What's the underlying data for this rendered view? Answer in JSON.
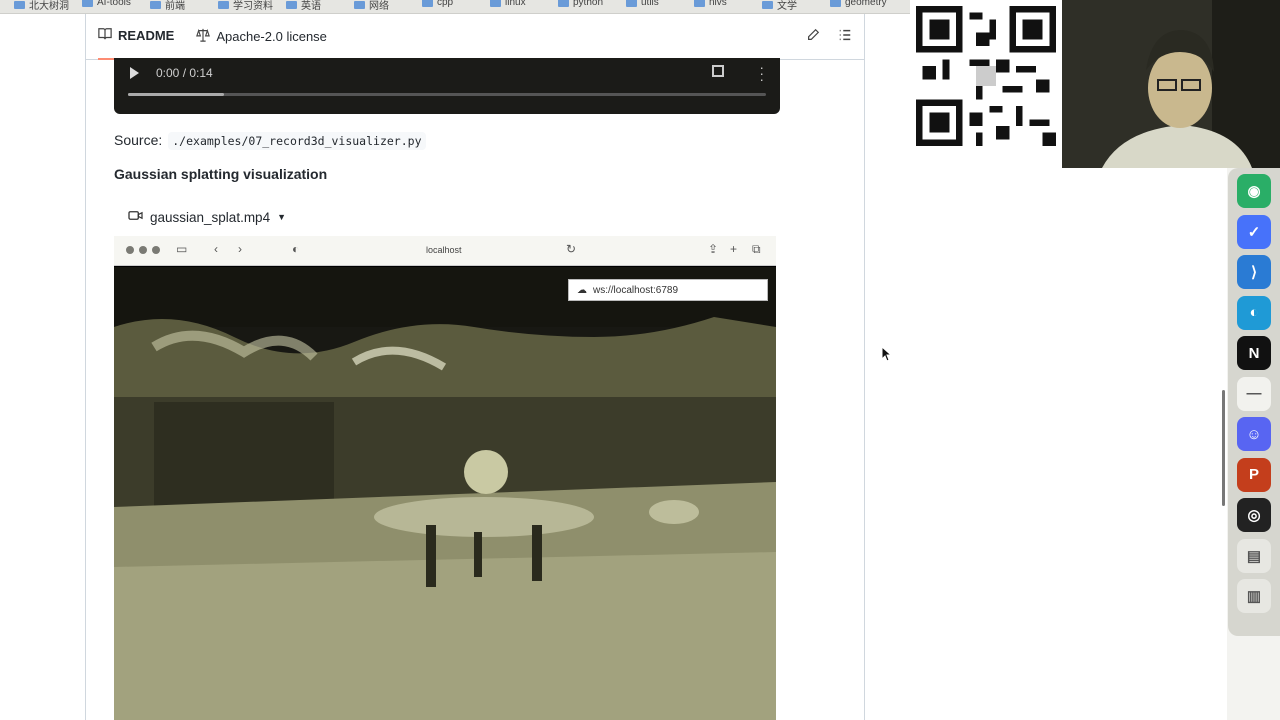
{
  "bookmarks": [
    "北大树洞",
    "AI-tools",
    "前端",
    "学习资料",
    "英语",
    "网络",
    "cpp",
    "linux",
    "python",
    "utils",
    "nlvs",
    "文学",
    "geometry"
  ],
  "readme": {
    "tabs": [
      {
        "label": "README",
        "icon": "book-icon",
        "active": true
      },
      {
        "label": "Apache-2.0 license",
        "icon": "scale-icon",
        "active": false
      }
    ],
    "video1": {
      "time": "0:00 / 0:14",
      "progress": 0.15
    },
    "source": {
      "label": "Source:",
      "path": "./examples/07_record3d_visualizer.py"
    },
    "heading": "Gaussian splatting visualization",
    "video2": {
      "file_label": "gaussian_splat.mp4",
      "window_address": "localhost",
      "ws_url": "ws://localhost:6789"
    }
  },
  "dock": [
    {
      "name": "wechat-icon",
      "glyph": "◉",
      "color": "#2aae67"
    },
    {
      "name": "ticktick-icon",
      "glyph": "✓",
      "color": "#4772fa"
    },
    {
      "name": "vscode-icon",
      "glyph": "⟩",
      "color": "#2a7bd4"
    },
    {
      "name": "edge-icon",
      "glyph": "◐",
      "color": "#1f9ad6"
    },
    {
      "name": "notion-icon",
      "glyph": "N",
      "color": "#111111"
    },
    {
      "name": "blank-app-icon",
      "glyph": "—",
      "color": "#f2f2ee"
    },
    {
      "name": "discord-icon",
      "glyph": "☺",
      "color": "#5865f2"
    },
    {
      "name": "powerpoint-icon",
      "glyph": "P",
      "color": "#c43e1c"
    },
    {
      "name": "obs-icon",
      "glyph": "◎",
      "color": "#222222"
    },
    {
      "name": "document-icon",
      "glyph": "▤",
      "color": "#e7e7e2"
    },
    {
      "name": "trash-icon",
      "glyph": "▥",
      "color": "#e7e7e2"
    }
  ]
}
